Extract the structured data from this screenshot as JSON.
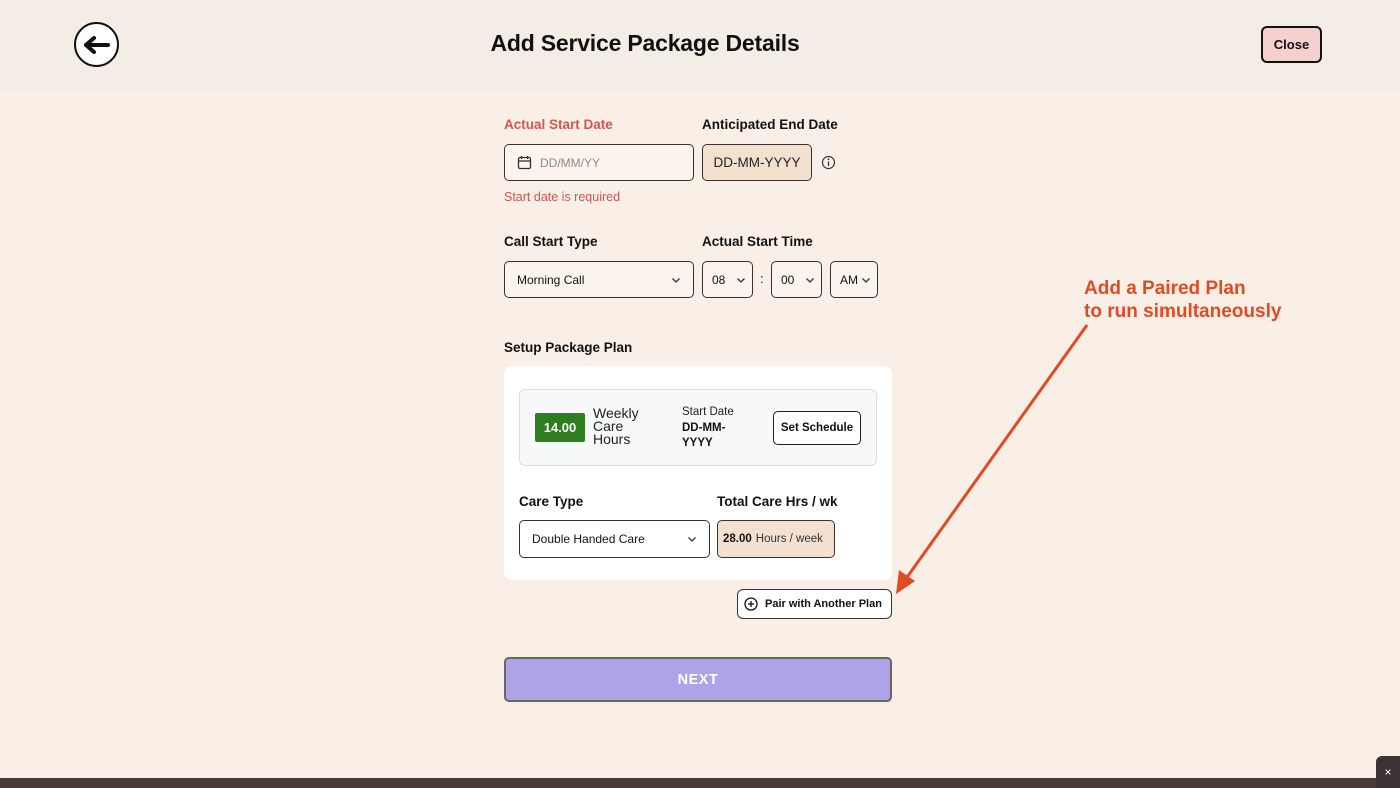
{
  "header": {
    "title": "Add Service Package Details",
    "close_label": "Close"
  },
  "form": {
    "start_date": {
      "label": "Actual Start Date",
      "placeholder": "DD/MM/YY",
      "error": "Start date is required"
    },
    "end_date": {
      "label": "Anticipated End Date",
      "value": "DD-MM-YYYY"
    },
    "call_start_type": {
      "label": "Call Start Type",
      "value": "Morning Call"
    },
    "start_time": {
      "label": "Actual Start Time",
      "hour": "08",
      "separator": ":",
      "minute": "00",
      "period": "AM"
    },
    "package_plan": {
      "label": "Setup Package Plan",
      "hours": "14.00",
      "hours_caption": "Weekly Care Hours",
      "start_date_label": "Start Date",
      "start_date_value": "DD-MM-YYYY",
      "set_schedule_label": "Set Schedule",
      "care_type_label": "Care Type",
      "care_type_value": "Double Handed Care",
      "total_label": "Total Care Hrs / wk",
      "total_value": "28.00",
      "total_unit": "Hours / week"
    },
    "pair_label": "Pair with Another Plan",
    "next_label": "NEXT"
  },
  "annotation": {
    "line1": "Add a Paired Plan",
    "line2": "to run simultaneously",
    "color": "#e24a24"
  },
  "corner_close": "×"
}
